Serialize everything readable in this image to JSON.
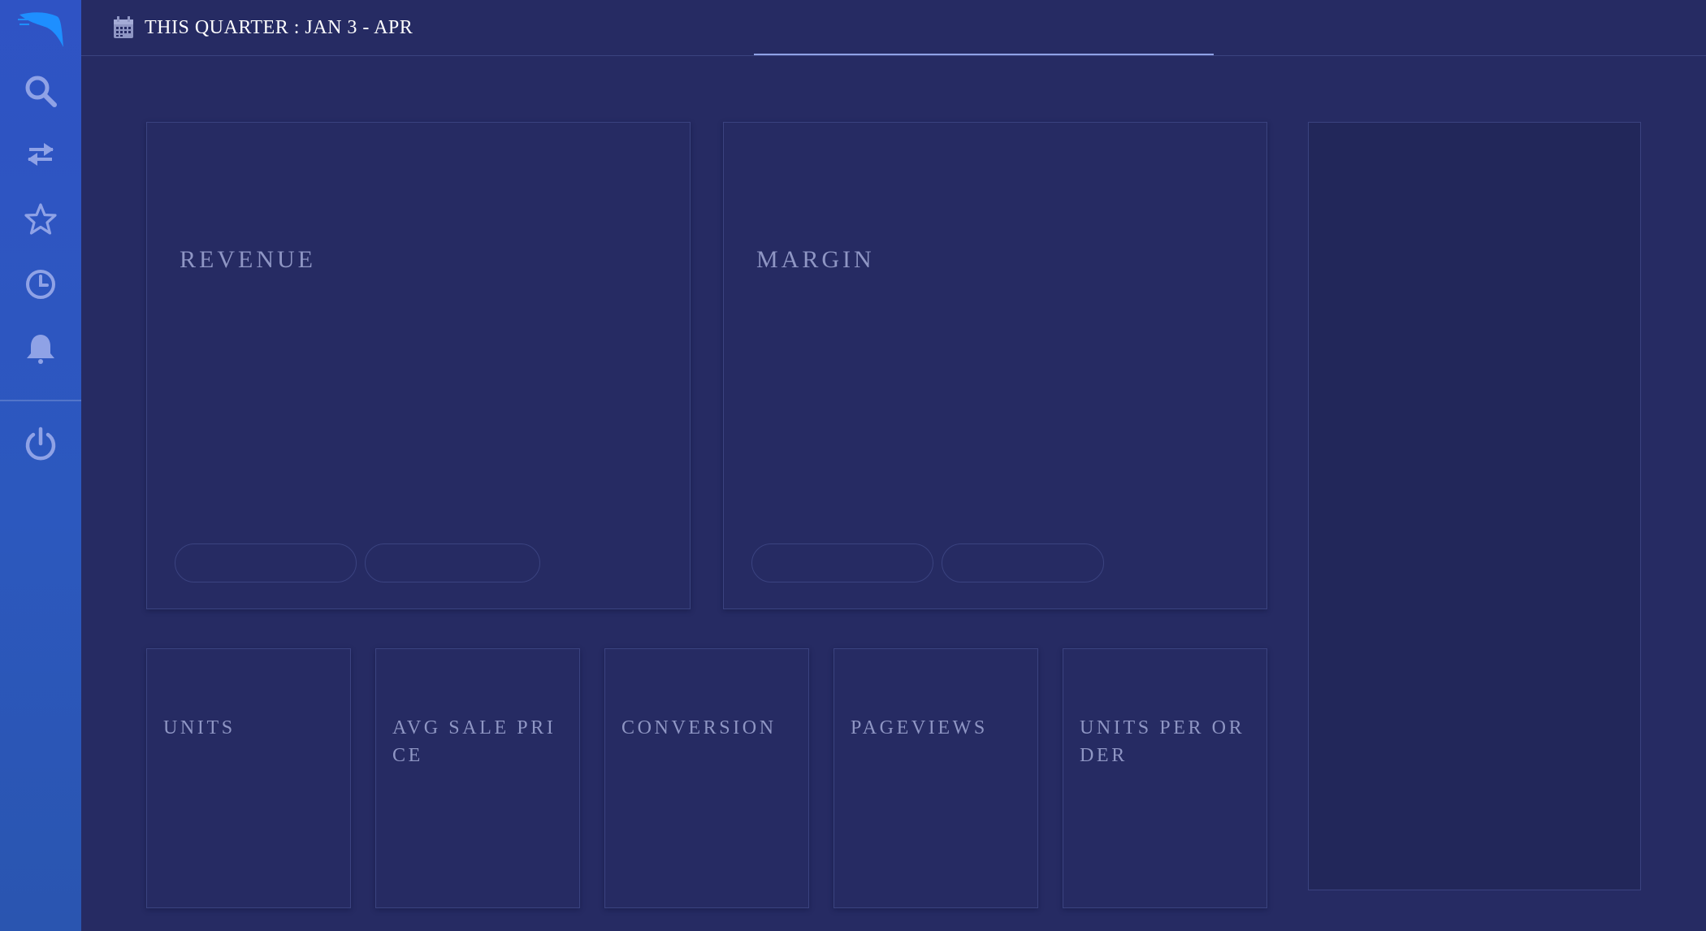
{
  "header": {
    "date_range_label": "THIS QUARTER : JAN 3 - APR"
  },
  "sidebar": {
    "items": [
      {
        "name": "search",
        "icon": "search-icon"
      },
      {
        "name": "transfer",
        "icon": "swap-arrows-icon"
      },
      {
        "name": "favorites",
        "icon": "star-icon"
      },
      {
        "name": "history",
        "icon": "clock-icon"
      },
      {
        "name": "notifications",
        "icon": "bell-icon"
      },
      {
        "name": "power",
        "icon": "power-icon"
      }
    ]
  },
  "cards": {
    "revenue": {
      "title": "REVENUE"
    },
    "margin": {
      "title": "MARGIN"
    },
    "units": {
      "title": "UNITS"
    },
    "avg_sale_price": {
      "title": "AVG SALE PRICE"
    },
    "conversion": {
      "title": "CONVERSION"
    },
    "pageviews": {
      "title": "PAGEVIEWS"
    },
    "units_per_order": {
      "title": "UNITS PER ORDER"
    }
  },
  "colors": {
    "background": "#262b63",
    "sidebar": "#2f53c4",
    "card_border": "#3b4380",
    "card_title": "#8f96c4",
    "icon": "#8fa2e6",
    "logo": "#1e8fff"
  }
}
